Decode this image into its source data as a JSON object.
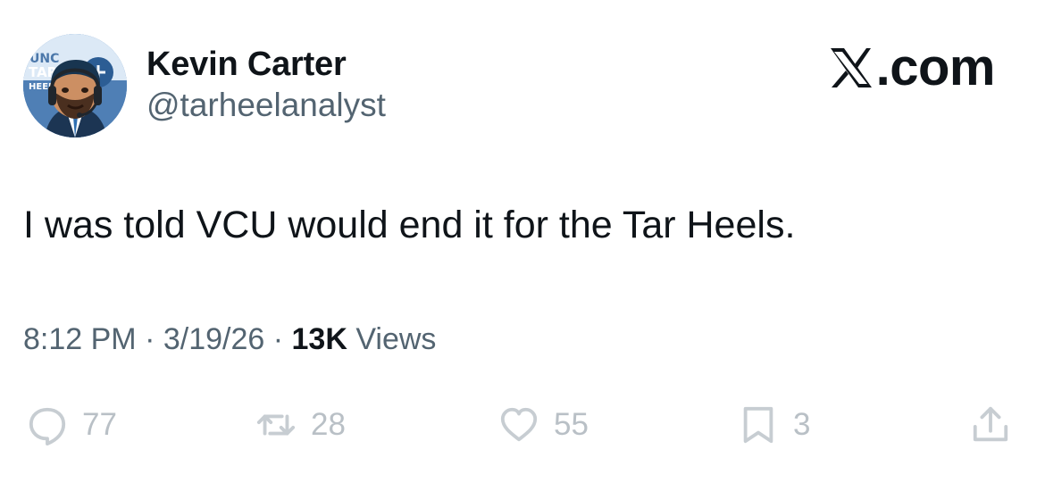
{
  "user": {
    "display_name": "Kevin Carter",
    "handle": "@tarheelanalyst",
    "avatar_icon": "cartoon-avatar-icon",
    "avatar_text": [
      "UNC",
      "TAR",
      "HEELS"
    ]
  },
  "brand": {
    "label": ".com",
    "icon": "x-logo-icon"
  },
  "tweet": {
    "text": "I was told VCU would end it for the Tar Heels."
  },
  "meta": {
    "time": "8:12 PM",
    "separator_1": " · ",
    "date": "3/19/26",
    "separator_2": " · ",
    "views_count": "13K",
    "views_label": " Views"
  },
  "actions": {
    "reply": {
      "icon": "reply-icon",
      "count": "77"
    },
    "retweet": {
      "icon": "retweet-icon",
      "count": "28"
    },
    "like": {
      "icon": "heart-icon",
      "count": "55"
    },
    "bookmark": {
      "icon": "bookmark-icon",
      "count": "3"
    },
    "share": {
      "icon": "share-icon"
    }
  },
  "colors": {
    "text_primary": "#0f1419",
    "text_secondary": "#536471",
    "action_icons": "#c7cdd2",
    "avatar_background": "#5b87b8"
  }
}
